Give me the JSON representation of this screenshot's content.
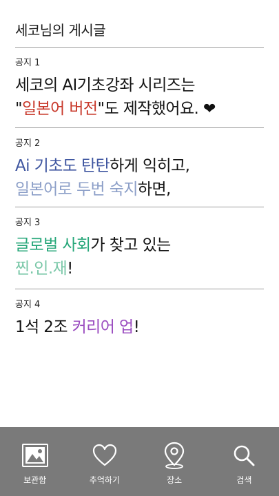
{
  "header": {
    "title": "세코님의 게시글"
  },
  "notices": [
    {
      "label": "공지 1",
      "line1": {
        "a": "세코의 AI기초강좌 시리즈는"
      },
      "line2": {
        "a": "\"",
        "b": "일본어 버전",
        "c": "\"도 제작했어요. ",
        "heart": "❤"
      }
    },
    {
      "label": "공지 2",
      "line1": {
        "a": "Ai 기초도 탄탄",
        "b": "하게 익히고,"
      },
      "line2": {
        "a": "일본어로 두번 숙지",
        "b": "하면,"
      }
    },
    {
      "label": "공지 3",
      "line1": {
        "a": "글로벌 사회",
        "b": "가 찾고 있는"
      },
      "line2": {
        "a": "찐.인.재",
        "b": "!"
      }
    },
    {
      "label": "공지 4",
      "line1": {
        "a": "1석 2조 ",
        "b": "커리어 업",
        "c": "!"
      }
    }
  ],
  "bottom_nav": [
    {
      "label": "보관함",
      "icon": "gallery-icon"
    },
    {
      "label": "추억하기",
      "icon": "heart-icon"
    },
    {
      "label": "장소",
      "icon": "map-pin-icon"
    },
    {
      "label": "검색",
      "icon": "search-icon"
    }
  ],
  "colors": {
    "red": "#c8392b",
    "blue": "#3f56a0",
    "lightblue": "#8c9fc8",
    "green": "#27a77a",
    "lightgreen": "#79c7a7",
    "purple": "#9b4dc0",
    "nav_bg": "#7a7a7a"
  }
}
